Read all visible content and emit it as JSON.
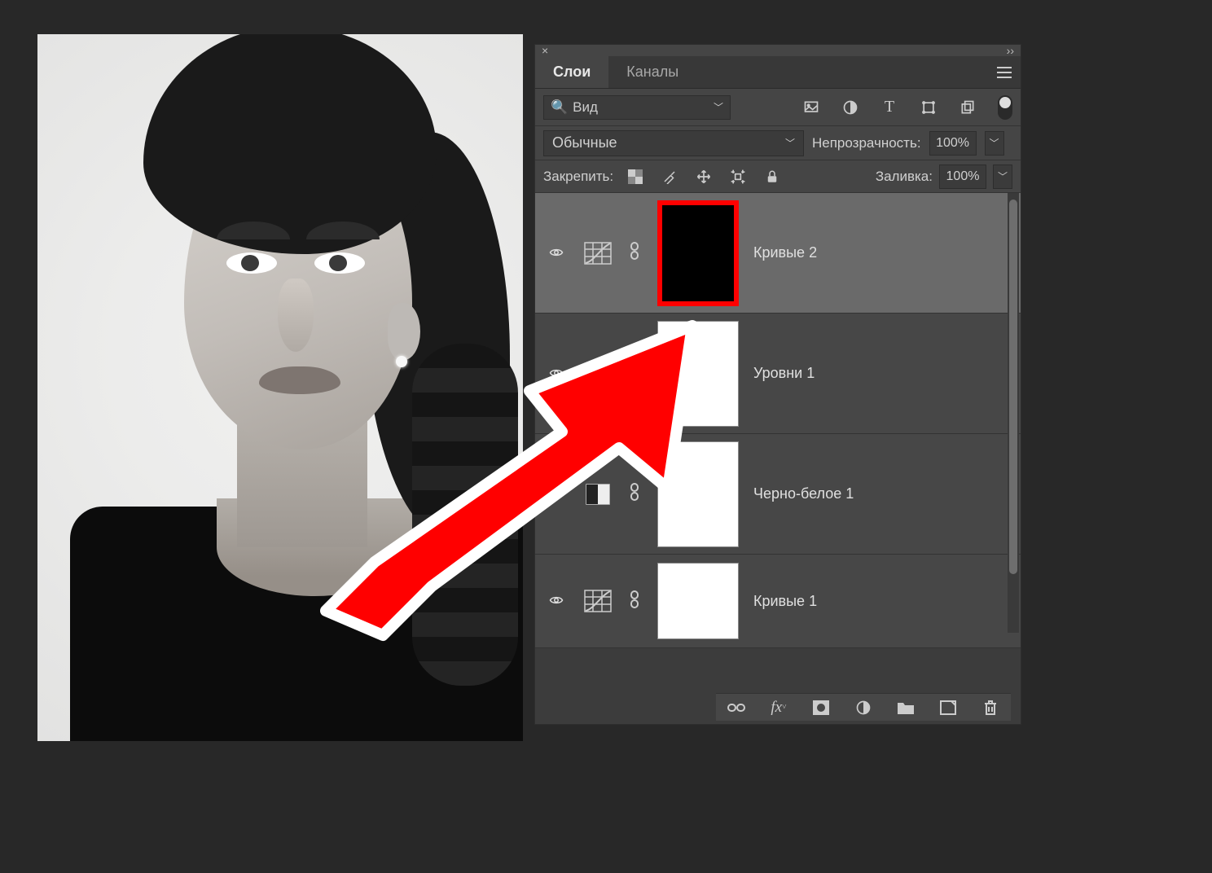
{
  "panel": {
    "tabs": {
      "layers": "Слои",
      "channels": "Каналы"
    },
    "search_placeholder": "Вид",
    "blend_mode": "Обычные",
    "opacity_label": "Непрозрачность:",
    "opacity_value": "100%",
    "lock_label": "Закрепить:",
    "fill_label": "Заливка:",
    "fill_value": "100%"
  },
  "layers": [
    {
      "name": "Кривые 2",
      "adj_icon": "curves",
      "mask": "black",
      "selected": true
    },
    {
      "name": "Уровни 1",
      "adj_icon": "",
      "mask": "white",
      "selected": false
    },
    {
      "name": "Черно-белое 1",
      "adj_icon": "bw",
      "mask": "white",
      "selected": false
    },
    {
      "name": "Кривые 1",
      "adj_icon": "curves",
      "mask": "white",
      "selected": false
    }
  ],
  "icons": {
    "filter_pixel": "image-icon",
    "filter_adjust": "circle-half-icon",
    "filter_type": "T",
    "filter_shape": "crop-icon",
    "filter_smart": "copy-icon"
  },
  "colors": {
    "highlight_red": "#ff0000"
  }
}
